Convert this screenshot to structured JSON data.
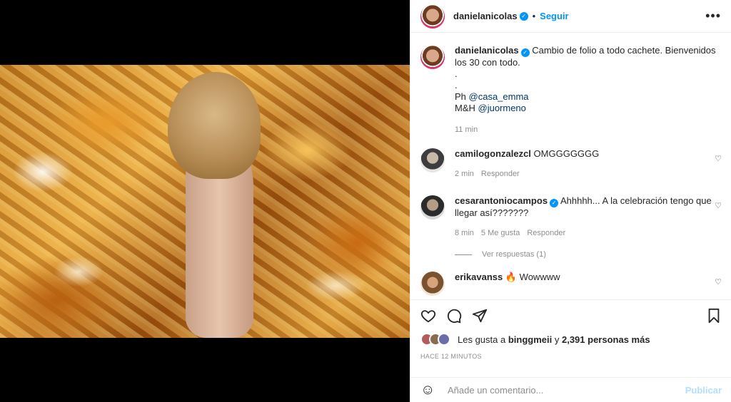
{
  "post": {
    "username": "danielanicolas",
    "follow_label": "Seguir",
    "more_label": "•••",
    "caption": {
      "text_line1": "Cambio de folio a todo cachete. Bienvenidos",
      "text_line2": "los 30 con todo.",
      "dot1": ".",
      "dot2": ".",
      "ph_prefix": "Ph ",
      "ph_mention": "@casa_emma",
      "mh_prefix": "M&H ",
      "mh_mention": "@juormeno",
      "time": "11 min"
    }
  },
  "comments": [
    {
      "username": "camilogonzalezcl",
      "text": "OMGGGGGGG",
      "time": "2 min",
      "reply_label": "Responder"
    },
    {
      "username": "cesarantoniocampos",
      "text_line1": "Ahhhhh... A la celebración tengo que",
      "text_line2": "llegar así???????",
      "time": "8 min",
      "likes": "5 Me gusta",
      "reply_label": "Responder",
      "view_replies": "Ver respuestas (1)"
    },
    {
      "username": "erikavanss",
      "emoji": "🔥",
      "text": "Wowwww"
    }
  ],
  "likes": {
    "prefix": "Les gusta a ",
    "user": "binggmeii",
    "middle": " y ",
    "count": "2,391 personas más"
  },
  "timestamp": "HACE 12 MINUTOS",
  "add_comment": {
    "placeholder": "Añade un comentario...",
    "publish_label": "Publicar"
  },
  "colors": {
    "accent": "#0095f6",
    "publish_disabled": "#b2dffc",
    "muted": "#8e8e8e"
  }
}
